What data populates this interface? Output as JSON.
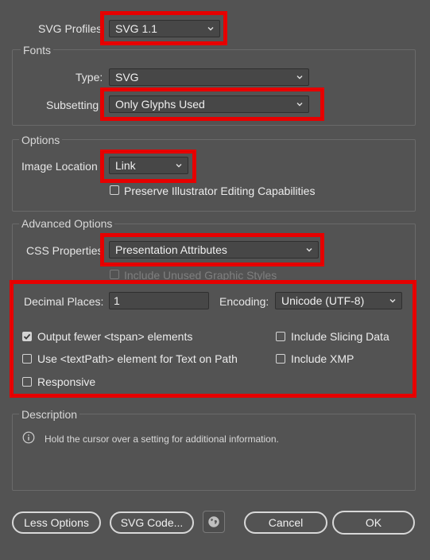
{
  "svg_profiles": {
    "label": "SVG Profiles",
    "value": "SVG 1.1"
  },
  "fonts": {
    "title": "Fonts",
    "type_label": "Type:",
    "type_value": "SVG",
    "subsetting_label": "Subsetting",
    "subsetting_value": "Only Glyphs Used"
  },
  "options": {
    "title": "Options",
    "image_location_label": "Image Location",
    "image_location_value": "Link",
    "preserve_label": "Preserve Illustrator Editing Capabilities",
    "preserve_checked": false
  },
  "advanced": {
    "title": "Advanced Options",
    "css_label": "CSS Properties",
    "css_value": "Presentation Attributes",
    "include_unused_label": "Include Unused Graphic Styles",
    "include_unused_checked": false,
    "decimal_label": "Decimal Places:",
    "decimal_value": "1",
    "encoding_label": "Encoding:",
    "encoding_value": "Unicode (UTF-8)",
    "output_fewer_label": "Output fewer <tspan> elements",
    "output_fewer_checked": true,
    "use_textpath_label": "Use <textPath> element for Text on Path",
    "use_textpath_checked": false,
    "responsive_label": "Responsive",
    "responsive_checked": false,
    "slicing_label": "Include Slicing Data",
    "slicing_checked": false,
    "xmp_label": "Include XMP",
    "xmp_checked": false
  },
  "description": {
    "title": "Description",
    "text": "Hold the cursor over a setting for additional information."
  },
  "buttons": {
    "less_options": "Less Options",
    "svg_code": "SVG Code...",
    "cancel": "Cancel",
    "ok": "OK"
  },
  "colors": {
    "background": "#535353",
    "highlight": "#e60000"
  },
  "icons": {
    "dropdown": "chevron-down-icon",
    "info": "info-icon",
    "globe": "globe-icon",
    "checkmark": "checkmark-icon"
  }
}
